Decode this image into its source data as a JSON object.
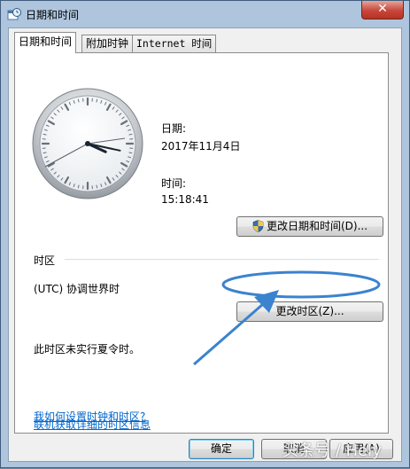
{
  "window": {
    "title": "日期和时间",
    "close_label": "✕"
  },
  "tabs": [
    {
      "label": "日期和时间",
      "active": true
    },
    {
      "label": "附加时钟",
      "active": false
    },
    {
      "label": "Internet 时间",
      "active": false
    }
  ],
  "datetime": {
    "date_label": "日期:",
    "date_value": "2017年11月4日",
    "time_label": "时间:",
    "time_value": "15:18:41",
    "change_button": "更改日期和时间(D)..."
  },
  "timezone": {
    "section_label": "时区",
    "current": "(UTC) 协调世界时",
    "change_button": "更改时区(Z)...",
    "dst_note": "此时区未实行夏令时。"
  },
  "links": {
    "online_info": "联机获取详细的时区信息",
    "how_to": "我如何设置时钟和时区?"
  },
  "footer": {
    "ok": "确定",
    "cancel": "取消",
    "apply": "应用(A)"
  },
  "watermark": "头条号 / Hely",
  "colors": {
    "annotation": "#3a83cf",
    "link": "#0066cc",
    "close": "#c7473a"
  }
}
